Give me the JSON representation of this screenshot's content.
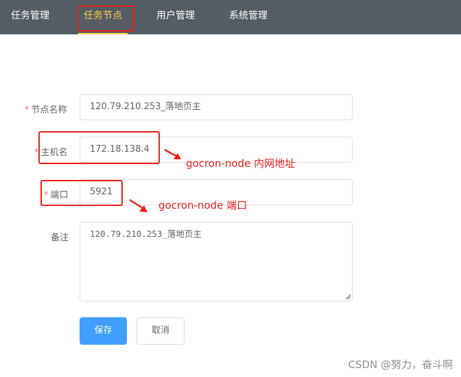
{
  "nav": {
    "items": [
      {
        "label": "任务管理",
        "active": false
      },
      {
        "label": "任务节点",
        "active": true
      },
      {
        "label": "用户管理",
        "active": false
      },
      {
        "label": "系统管理",
        "active": false
      }
    ],
    "background": "#545c64",
    "active_color": "#ffd04b"
  },
  "form": {
    "node_name": {
      "label": "节点名称",
      "required": true,
      "value": "120.79.210.253_落地页主"
    },
    "hostname": {
      "label": "主机名",
      "required": true,
      "value": "172.18.138.4"
    },
    "port": {
      "label": "端口",
      "required": true,
      "value": "5921"
    },
    "remark": {
      "label": "备注",
      "required": false,
      "value": "120.79.210.253_落地页主"
    },
    "required_mark": "*",
    "save_label": "保存",
    "cancel_label": "取消"
  },
  "annotations": {
    "hostname_note": "gocron-node 内网地址",
    "port_note": "gocron-node 端口",
    "color": "#e8201a"
  },
  "watermark": "CSDN @努力，奋斗啊"
}
